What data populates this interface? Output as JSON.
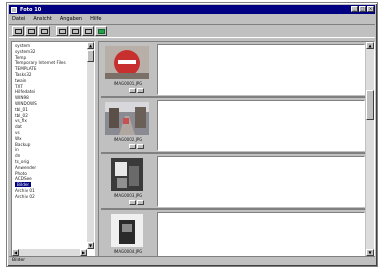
{
  "window": {
    "title": "Foto 10",
    "controls": [
      "_",
      "□",
      "×"
    ]
  },
  "menu": {
    "items": [
      "Datei",
      "Ansicht",
      "Angaben",
      "Hilfe"
    ]
  },
  "toolbar": {
    "buttons": [
      "view-icon",
      "list-icon",
      "rotate-icon",
      "select-icon",
      "grid-icon",
      "save-icon",
      "export-icon"
    ]
  },
  "tree": {
    "items": [
      "system",
      "system32",
      "Temp",
      "Temporary Internet Files",
      "TEMPLATE",
      "Tasks32",
      "twain",
      "TXT",
      "Hilfedatei",
      "WIN98",
      "WINDOWS",
      "tbl_01",
      "tbl_02",
      "vs_fix",
      "dat",
      "vs",
      "Wx",
      "Backup",
      "in",
      "dn",
      "ts_orig",
      "Anwender",
      "Photo",
      "ACDSee",
      "Bilder",
      "Archiv 01",
      "Archiv 02"
    ],
    "selected": "Bilder"
  },
  "thumbnails": [
    {
      "caption": "IMAG0001.JPG",
      "kind": "red-circle"
    },
    {
      "caption": "IMAG0002.JPG",
      "kind": "street"
    },
    {
      "caption": "IMAG0003.JPG",
      "kind": "dark"
    },
    {
      "caption": "IMAG0004.JPG",
      "kind": "interior"
    }
  ],
  "status": {
    "text": "Bilder"
  },
  "colors": {
    "titlebar": "#000080",
    "face": "#c0c0c0",
    "selection": "#000080"
  }
}
